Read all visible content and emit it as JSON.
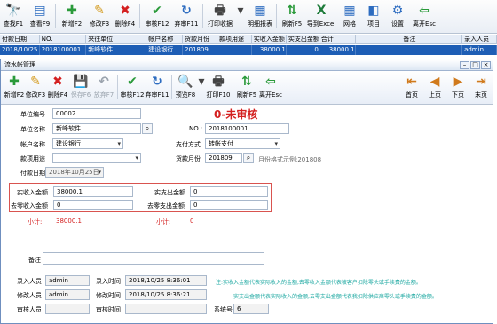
{
  "toolbar": [
    {
      "label": "查找F1",
      "icon": "binoculars-icon",
      "glyph": "🔭",
      "color": "#333"
    },
    {
      "label": "查看F9",
      "icon": "view-doc-icon",
      "glyph": "▤",
      "color": "#2d6cc0"
    },
    {
      "label": "新增F2",
      "icon": "new-doc-icon",
      "glyph": "✚",
      "color": "#2a9a3a"
    },
    {
      "label": "修改F3",
      "icon": "edit-doc-icon",
      "glyph": "✎",
      "color": "#d49a1c"
    },
    {
      "label": "删除F4",
      "icon": "delete-icon",
      "glyph": "✖",
      "color": "#d42020"
    },
    {
      "label": "审核F12",
      "icon": "approve-icon",
      "glyph": "✔",
      "color": "#2a9a3a"
    },
    {
      "label": "弃审F11",
      "icon": "unapprove-icon",
      "glyph": "↻",
      "color": "#2d6cc0"
    },
    {
      "label": "打印收据",
      "icon": "printer-icon",
      "glyph": "🖶",
      "color": "#444"
    },
    {
      "label": "",
      "icon": "dropdown-icon",
      "glyph": "▾",
      "color": "#444"
    },
    {
      "label": "明细报表",
      "icon": "report-icon",
      "glyph": "▦",
      "color": "#2d6cc0"
    },
    {
      "label": "刷新F5",
      "icon": "refresh-icon",
      "glyph": "⇅",
      "color": "#2a9a3a"
    },
    {
      "label": "导到Excel",
      "icon": "excel-icon",
      "glyph": "X",
      "color": "#1e7b3a"
    },
    {
      "label": "网格",
      "icon": "grid-icon",
      "glyph": "▦",
      "color": "#2d6cc0"
    },
    {
      "label": "项目",
      "icon": "project-icon",
      "glyph": "◧",
      "color": "#2d6cc0"
    },
    {
      "label": "设置",
      "icon": "settings-icon",
      "glyph": "⚙",
      "color": "#2d6cc0"
    },
    {
      "label": "离开Esc",
      "icon": "exit-icon",
      "glyph": "⇦",
      "color": "#2a9a3a"
    }
  ],
  "grid": {
    "headers": [
      "付款日期",
      "NO.",
      "来往单位",
      "帐户名称",
      "货款月份",
      "款项用途",
      "实收入金额",
      "实支出金额",
      "合计",
      "备注",
      "录入人员"
    ],
    "row": [
      "2018/10/25",
      "2018100001",
      "新峰软件",
      "建设银行",
      "201809",
      "",
      "38000.1",
      "0",
      "38000.1",
      "",
      "admin"
    ]
  },
  "window": {
    "title": "流水帐管理"
  },
  "toolbar2": [
    {
      "label": "新增F2",
      "icon": "new-doc-icon",
      "glyph": "✚",
      "color": "#2a9a3a",
      "disabled": false
    },
    {
      "label": "修改F3",
      "icon": "edit-doc-icon",
      "glyph": "✎",
      "color": "#d49a1c",
      "disabled": false
    },
    {
      "label": "删除F4",
      "icon": "delete-icon",
      "glyph": "✖",
      "color": "#d42020",
      "disabled": false
    },
    {
      "label": "保存F6",
      "icon": "save-icon",
      "glyph": "💾",
      "color": "#9aa3ad",
      "disabled": true
    },
    {
      "label": "放弃F7",
      "icon": "undo-icon",
      "glyph": "↶",
      "color": "#9aa3ad",
      "disabled": true
    },
    {
      "label": "审核F12",
      "icon": "approve-icon",
      "glyph": "✔",
      "color": "#2a9a3a",
      "disabled": false
    },
    {
      "label": "弃审F11",
      "icon": "unapprove-icon",
      "glyph": "↻",
      "color": "#2d6cc0",
      "disabled": false
    },
    {
      "label": "预览F8",
      "icon": "preview-icon",
      "glyph": "🔍",
      "color": "#2d6cc0",
      "disabled": false
    },
    {
      "label": "",
      "icon": "dropdown-icon",
      "glyph": "▾",
      "color": "#444",
      "disabled": false
    },
    {
      "label": "打印F10",
      "icon": "printer-icon",
      "glyph": "🖶",
      "color": "#444",
      "disabled": false
    },
    {
      "label": "刷新F5",
      "icon": "refresh-icon",
      "glyph": "⇅",
      "color": "#2a9a3a",
      "disabled": false
    },
    {
      "label": "离开Esc",
      "icon": "exit-icon",
      "glyph": "⇦",
      "color": "#2a9a3a",
      "disabled": false
    }
  ],
  "nav": [
    {
      "label": "首页",
      "icon": "first-page-icon",
      "glyph": "⇤",
      "color": "#d07a1c"
    },
    {
      "label": "上页",
      "icon": "prev-page-icon",
      "glyph": "◀",
      "color": "#d07a1c"
    },
    {
      "label": "下页",
      "icon": "next-page-icon",
      "glyph": "▶",
      "color": "#d07a1c"
    },
    {
      "label": "末页",
      "icon": "last-page-icon",
      "glyph": "⇥",
      "color": "#d07a1c"
    }
  ],
  "form": {
    "unit_code_label": "单位编号",
    "unit_code": "00002",
    "status": "0-未审核",
    "unit_name_label": "单位名称",
    "unit_name": "新峰软件",
    "no_label": "NO.:",
    "no": "2018100001",
    "account_label": "帐户名称",
    "account": "建设银行",
    "pay_method_label": "支付方式",
    "pay_method": "转帐支付",
    "purpose_label": "款项用途",
    "purpose": "",
    "month_label": "货款月份",
    "month": "201809",
    "month_hint": "月份格式示例:201808",
    "date_label": "付款日期",
    "date": "2018年10月25日",
    "income_label": "实收入金额",
    "income": "38000.1",
    "expense_label": "实支出金额",
    "expense": "0",
    "round_income_label": "去零收入金额",
    "round_income": "0",
    "round_expense_label": "去零支出金额",
    "round_expense": "0",
    "subtotal_label": "小计:",
    "subtotal_income": "38000.1",
    "subtotal_expense": "0",
    "remark_label": "备注",
    "remark": "",
    "entry_user_label": "录入人员",
    "entry_user": "admin",
    "entry_time_label": "录入时间",
    "entry_time": "2018/10/25 8:36:01",
    "modify_user_label": "修改人员",
    "modify_user": "admin",
    "modify_time_label": "修改时间",
    "modify_time": "2018/10/25 8:36:21",
    "audit_user_label": "审核人员",
    "audit_user": "",
    "audit_time_label": "审核时间",
    "audit_time": "",
    "sys_no_label": "系统号",
    "sys_no": "6",
    "note1": "注:实收入金额代表实际收入的金额,去零收入金额代表被客户扣除零头或手续费的金额。",
    "note2": "实支出金额代表实际收入的金额,去零支出金额代表我扣除供应商零头或手续费的金额。"
  }
}
